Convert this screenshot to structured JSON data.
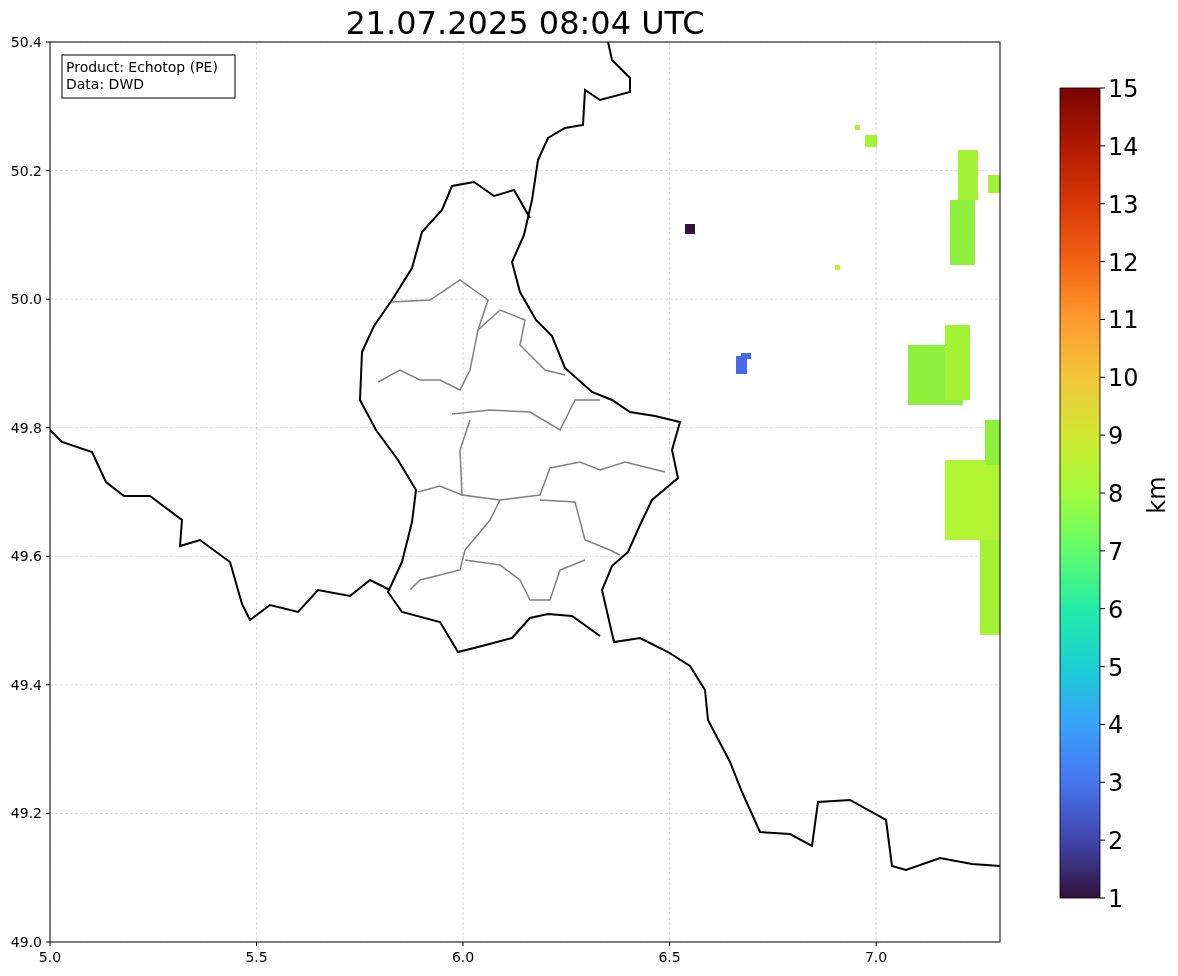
{
  "title": "21.07.2025 08:04 UTC",
  "info": [
    "Product: Echotop (PE)",
    "Data: DWD"
  ],
  "map": {
    "xticks": [
      "5.0",
      "5.5",
      "6.0",
      "6.5",
      "7.0"
    ],
    "yticks": [
      "50.4",
      "50.2",
      "50.0",
      "49.8",
      "49.6",
      "49.4",
      "49.2",
      "49.0"
    ]
  },
  "colorbar": {
    "label": "km",
    "ticks": [
      "15",
      "14",
      "13",
      "12",
      "11",
      "10",
      "9",
      "8",
      "7",
      "6",
      "5",
      "4",
      "3",
      "2",
      "1"
    ]
  }
}
